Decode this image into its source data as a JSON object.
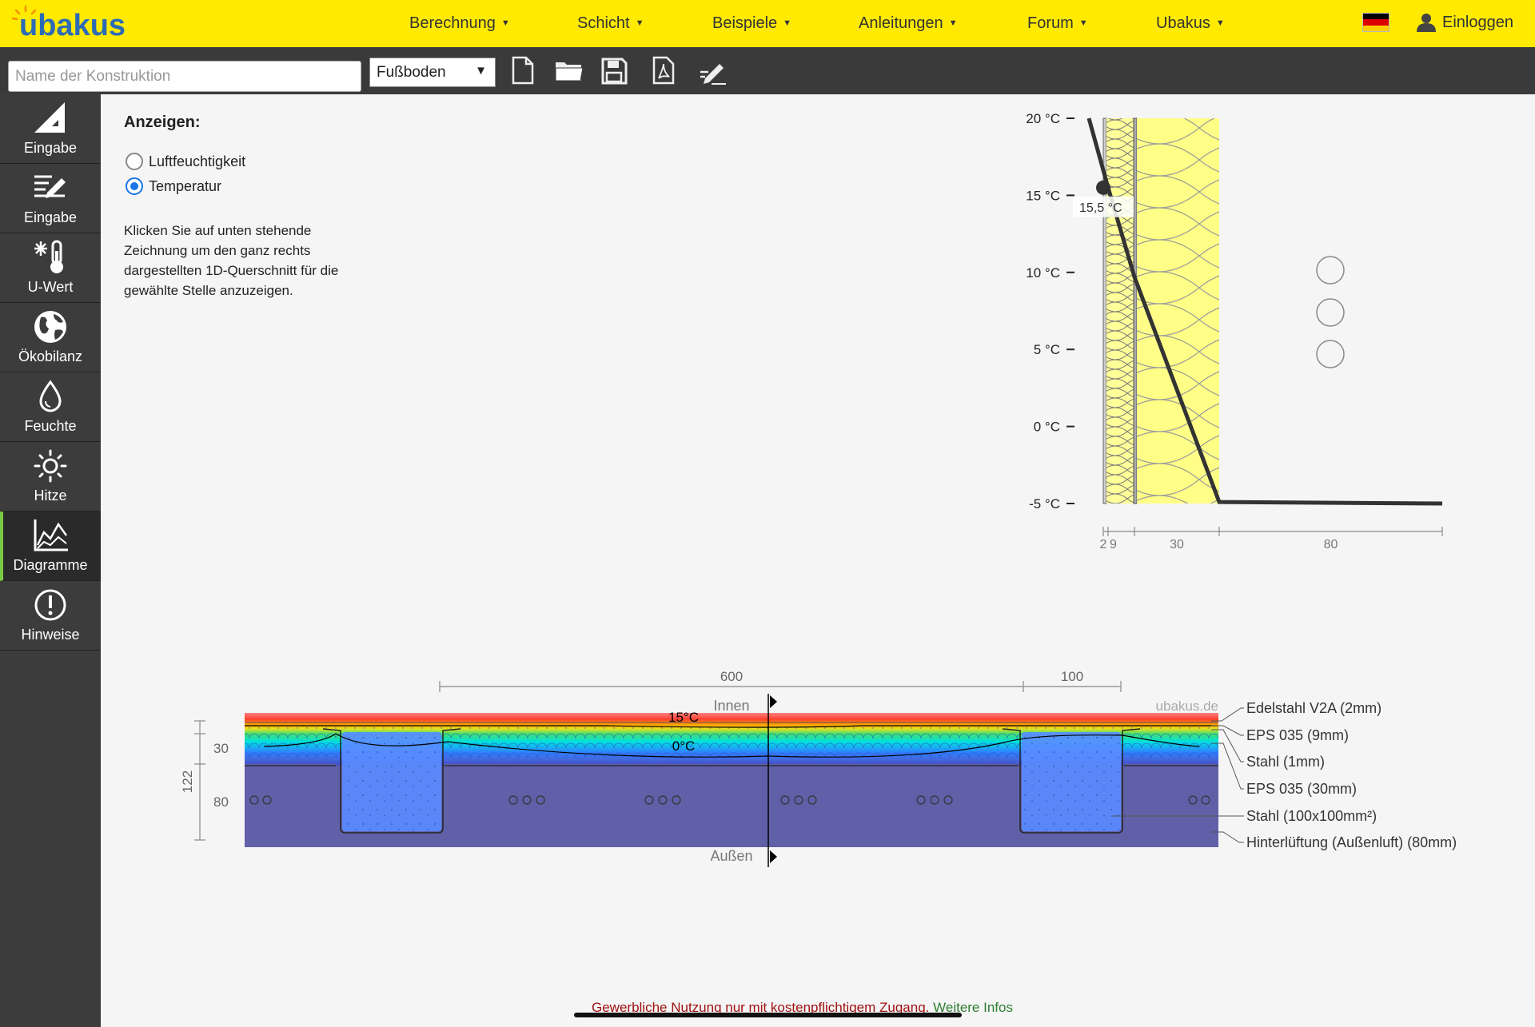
{
  "app": {
    "logo_text": "ubakus"
  },
  "nav": {
    "items": [
      {
        "label": "Berechnung"
      },
      {
        "label": "Schicht"
      },
      {
        "label": "Beispiele"
      },
      {
        "label": "Anleitungen"
      },
      {
        "label": "Forum"
      },
      {
        "label": "Ubakus"
      }
    ],
    "login_label": "Einloggen"
  },
  "toolbar": {
    "name_placeholder": "Name der Konstruktion",
    "name_value": "",
    "type_selected": "Fußboden",
    "icons": [
      "new-file-icon",
      "open-folder-icon",
      "save-icon",
      "pdf-icon",
      "edit-icon"
    ]
  },
  "sidebar": {
    "items": [
      {
        "label": "Eingabe",
        "icon": "drafting-triangle-icon"
      },
      {
        "label": "Eingabe",
        "icon": "layer-edit-icon"
      },
      {
        "label": "U-Wert",
        "icon": "thermometer-snowflake-icon"
      },
      {
        "label": "Ökobilanz",
        "icon": "globe-icon"
      },
      {
        "label": "Feuchte",
        "icon": "droplet-icon"
      },
      {
        "label": "Hitze",
        "icon": "sun-icon"
      },
      {
        "label": "Diagramme",
        "icon": "chart-icon",
        "active": true
      },
      {
        "label": "Hinweise",
        "icon": "exclamation-icon"
      }
    ]
  },
  "panel": {
    "title": "Anzeigen:",
    "options": [
      {
        "label": "Luftfeuchtigkeit",
        "checked": false
      },
      {
        "label": "Temperatur",
        "checked": true
      }
    ],
    "hint": "Klicken Sie auf unten stehende Zeichnung um den ganz rechts dargestellten 1D-Querschnitt für die gewählte Stelle anzuzeigen."
  },
  "chart_data": {
    "type": "line",
    "y_ticks": [
      "20 °C",
      "15 °C",
      "10 °C",
      "5 °C",
      "0 °C",
      "-5 °C"
    ],
    "ylim": [
      -5,
      20
    ],
    "marker_label": "15,5 °C",
    "marker_value": 15.5,
    "layer_thickness_labels": [
      "2",
      "9",
      "30",
      "80"
    ],
    "layer_thickness_mm": [
      2,
      9,
      30,
      80
    ],
    "x": [
      0,
      2,
      11,
      41,
      121
    ],
    "temperature": [
      20,
      15.5,
      9.7,
      -4.9,
      -5
    ]
  },
  "cross_section": {
    "dims_top": [
      "600",
      "100"
    ],
    "dims_left": [
      "30",
      "80",
      "122"
    ],
    "label_inside": "Innen",
    "label_outside": "Außen",
    "iso_15": "15°C",
    "iso_0": "0°C",
    "watermark": "ubakus.de",
    "layers": [
      "Edelstahl V2A (2mm)",
      "EPS 035 (9mm)",
      "Stahl (1mm)",
      "EPS 035 (30mm)",
      "Stahl (100x100mm²)",
      "Hinterlüftung (Außenluft) (80mm)"
    ]
  },
  "colors": {
    "nav_bg": "#ffea00",
    "toolbar_bg": "#3a3a3a",
    "sidebar_bg": "#3c3c3c",
    "active_accent": "#7ac943",
    "radio_accent": "#1a73e8"
  },
  "footer": {
    "notice": "Gewerbliche Nutzung nur mit kostenpflichtigem Zugang.",
    "link": "Weitere Infos"
  }
}
